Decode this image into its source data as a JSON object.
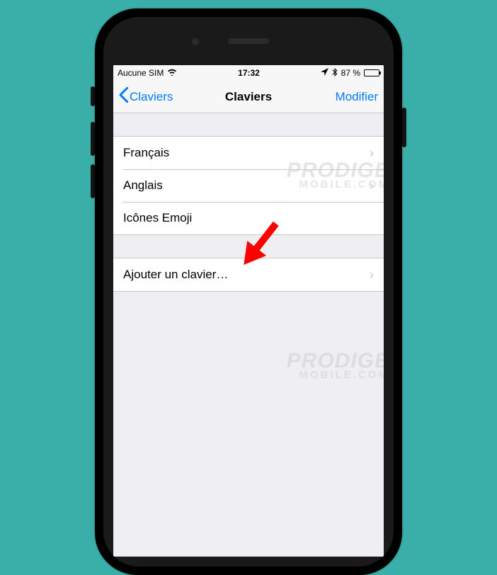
{
  "statusbar": {
    "carrier": "Aucune SIM",
    "time": "17:32",
    "battery_pct": "87 %"
  },
  "navbar": {
    "back_label": "Claviers",
    "title": "Claviers",
    "action_label": "Modifier"
  },
  "keyboards": {
    "items": [
      {
        "label": "Français"
      },
      {
        "label": "Anglais"
      },
      {
        "label": "Icônes Emoji"
      }
    ]
  },
  "add": {
    "label": "Ajouter un clavier…"
  },
  "watermark": {
    "primary": "PRODIGE",
    "secondary": "MOBILE.COM"
  }
}
